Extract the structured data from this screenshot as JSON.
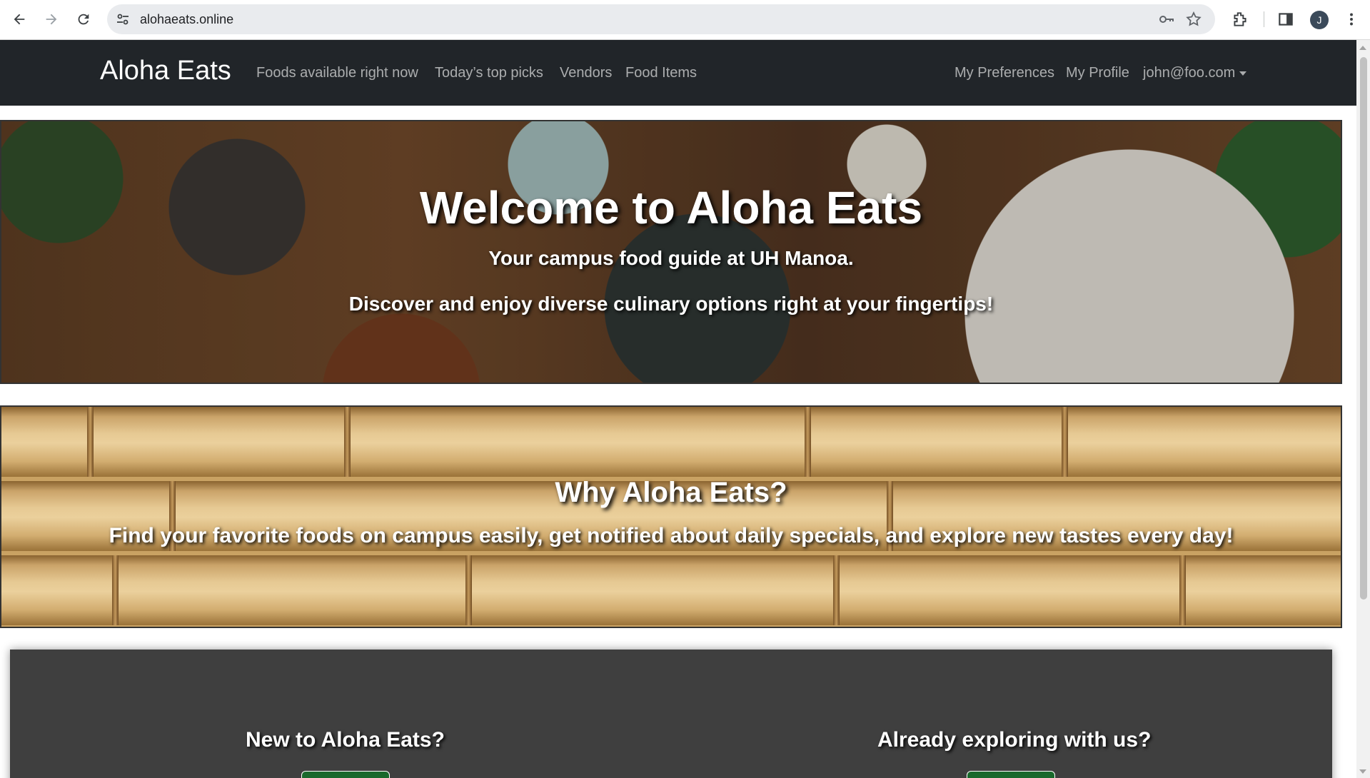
{
  "browser": {
    "url": "alohaeats.online",
    "avatar_initial": "J"
  },
  "nav": {
    "brand": "Aloha Eats",
    "left_links": [
      "Foods available right now",
      "Today’s top picks",
      "Vendors",
      "Food Items"
    ],
    "right_links": [
      "My Preferences",
      "My Profile"
    ],
    "user_menu": "john@foo.com"
  },
  "hero": {
    "title": "Welcome to Aloha Eats",
    "subtitle": "Your campus food guide at UH Manoa.",
    "tagline": "Discover and enjoy diverse culinary options right at your fingertips!"
  },
  "why": {
    "title": "Why Aloha Eats?",
    "text": "Find your favorite foods on campus easily, get notified about daily specials, and explore new tastes every day!"
  },
  "cta": {
    "new_heading": "New to Aloha Eats?",
    "existing_heading": "Already exploring with us?"
  },
  "colors": {
    "navbar": "#212529",
    "section_dark": "#3f3f3f",
    "button_green": "#19692c"
  }
}
